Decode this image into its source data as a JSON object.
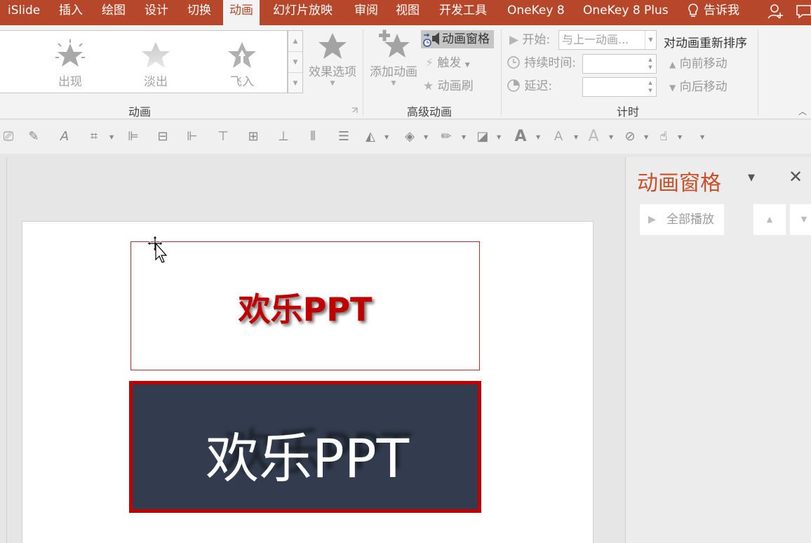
{
  "tabs": [
    {
      "label": "iSlide",
      "active": false
    },
    {
      "label": "插入",
      "active": false
    },
    {
      "label": "绘图",
      "active": false
    },
    {
      "label": "设计",
      "active": false
    },
    {
      "label": "切换",
      "active": false
    },
    {
      "label": "动画",
      "active": true
    },
    {
      "label": "幻灯片放映",
      "active": false
    },
    {
      "label": "审阅",
      "active": false
    },
    {
      "label": "视图",
      "active": false
    },
    {
      "label": "开发工具",
      "active": false
    },
    {
      "label": "OneKey 8",
      "active": false
    },
    {
      "label": "OneKey 8 Plus",
      "active": false
    }
  ],
  "tell_me": "告诉我",
  "ribbon": {
    "gallery": [
      {
        "label": "出现",
        "icon": "star-burst-icon"
      },
      {
        "label": "淡出",
        "icon": "star-fade-icon"
      },
      {
        "label": "飞入",
        "icon": "star-fly-icon"
      }
    ],
    "effect_options": "效果选项",
    "group_animation": "动画",
    "add_animation": "添加动画",
    "animation_pane": "动画窗格",
    "trigger": "触发",
    "animation_painter": "动画刷",
    "group_advanced": "高级动画",
    "start_label": "开始:",
    "start_value": "与上一动画...",
    "duration_label": "持续时间:",
    "delay_label": "延迟:",
    "group_timing": "计时",
    "reorder_title": "对动画重新排序",
    "move_earlier": "向前移动",
    "move_later": "向后移动"
  },
  "slide": {
    "box1_text": "欢乐PPT",
    "box2_text": "欢乐PPT",
    "box2_shadow_text": "欢乐PPT"
  },
  "pane": {
    "title": "动画窗格",
    "play_all": "全部播放"
  },
  "colors": {
    "accent": "#b7472a",
    "pane_title": "#c8502a",
    "text_red": "#c00000",
    "box2_bg": "#323c4e"
  }
}
